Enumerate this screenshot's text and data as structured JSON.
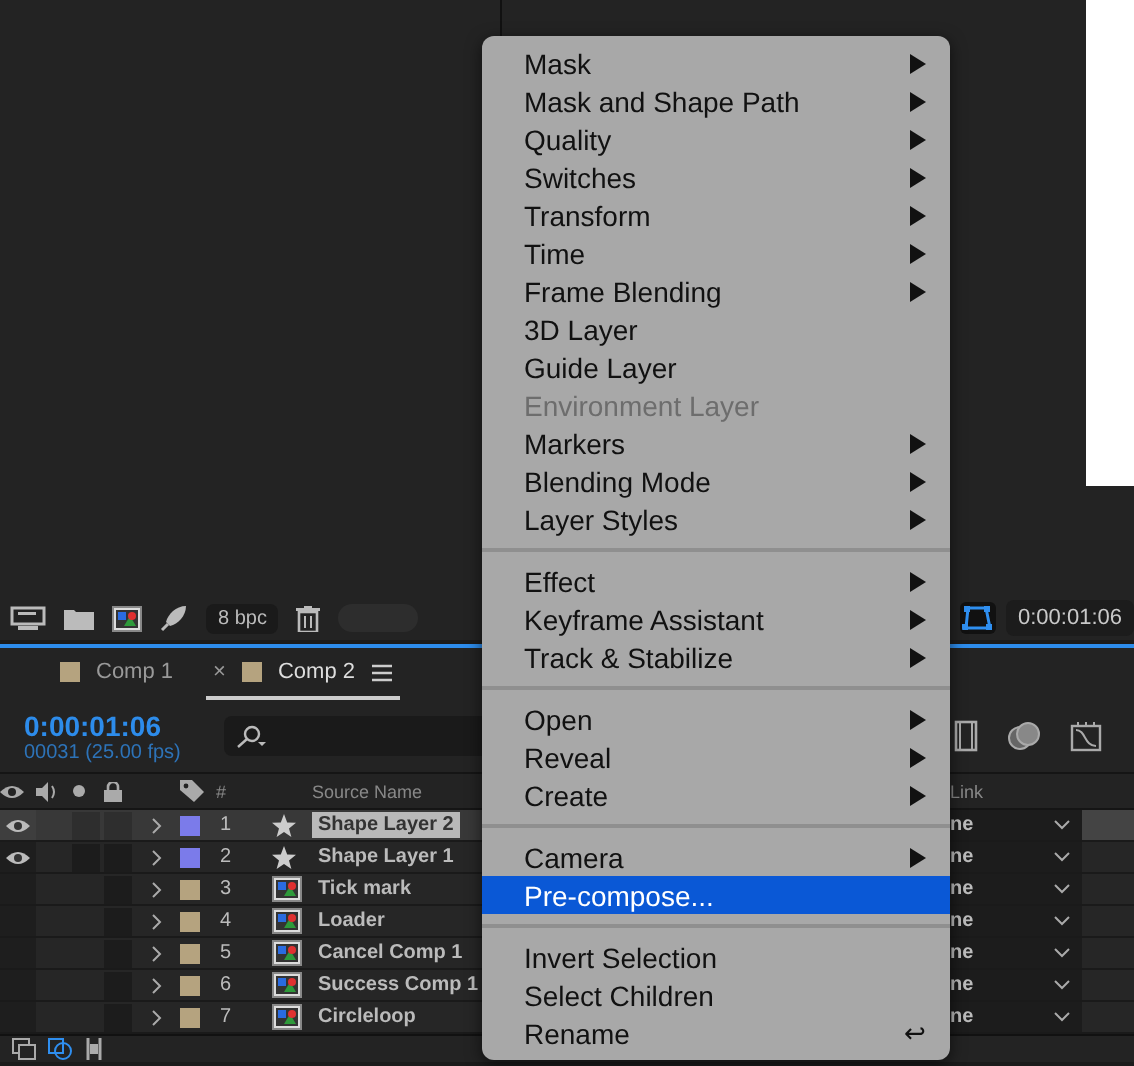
{
  "viewer": {
    "toolbar": {
      "bit_depth": "8 bpc",
      "time": "0:00:01:06"
    }
  },
  "timeline": {
    "tabs": [
      {
        "label": "Comp 1",
        "color": "#b5a37f",
        "selected": false
      },
      {
        "label": "Comp 2",
        "color": "#b5a37f",
        "selected": true,
        "close": "×"
      }
    ],
    "current_time": "0:00:01:06",
    "frame_info": "00031 (25.00 fps)",
    "columns": {
      "number": "#",
      "source_name": "Source Name",
      "parent": "Link"
    },
    "layers": [
      {
        "number": "1",
        "name": "Shape Layer 2",
        "color": "#7b7bea",
        "kind": "shape",
        "visible": true,
        "selected": true,
        "parent": "ne"
      },
      {
        "number": "2",
        "name": "Shape Layer 1",
        "color": "#7b7bea",
        "kind": "shape",
        "visible": true,
        "selected": false,
        "parent": "ne"
      },
      {
        "number": "3",
        "name": "Tick mark",
        "color": "#b5a37f",
        "kind": "comp",
        "visible": false,
        "selected": false,
        "parent": "ne"
      },
      {
        "number": "4",
        "name": "Loader",
        "color": "#b5a37f",
        "kind": "comp",
        "visible": false,
        "selected": false,
        "parent": "ne"
      },
      {
        "number": "5",
        "name": "Cancel Comp 1",
        "color": "#b5a37f",
        "kind": "comp",
        "visible": false,
        "selected": false,
        "parent": "ne"
      },
      {
        "number": "6",
        "name": "Success Comp 1",
        "color": "#b5a37f",
        "kind": "comp",
        "visible": false,
        "selected": false,
        "parent": "ne"
      },
      {
        "number": "7",
        "name": "Circleloop",
        "color": "#b5a37f",
        "kind": "comp",
        "visible": false,
        "selected": false,
        "parent": "ne"
      }
    ]
  },
  "context_menu": {
    "groups": [
      [
        {
          "label": "Mask",
          "submenu": true,
          "disabled": false,
          "selected": false
        },
        {
          "label": "Mask and Shape Path",
          "submenu": true,
          "disabled": false,
          "selected": false
        },
        {
          "label": "Quality",
          "submenu": true,
          "disabled": false,
          "selected": false
        },
        {
          "label": "Switches",
          "submenu": true,
          "disabled": false,
          "selected": false
        },
        {
          "label": "Transform",
          "submenu": true,
          "disabled": false,
          "selected": false
        },
        {
          "label": "Time",
          "submenu": true,
          "disabled": false,
          "selected": false
        },
        {
          "label": "Frame Blending",
          "submenu": true,
          "disabled": false,
          "selected": false
        },
        {
          "label": "3D Layer",
          "submenu": false,
          "disabled": false,
          "selected": false
        },
        {
          "label": "Guide Layer",
          "submenu": false,
          "disabled": false,
          "selected": false
        },
        {
          "label": "Environment Layer",
          "submenu": false,
          "disabled": true,
          "selected": false
        },
        {
          "label": "Markers",
          "submenu": true,
          "disabled": false,
          "selected": false
        },
        {
          "label": "Blending Mode",
          "submenu": true,
          "disabled": false,
          "selected": false
        },
        {
          "label": "Layer Styles",
          "submenu": true,
          "disabled": false,
          "selected": false
        }
      ],
      [
        {
          "label": "Effect",
          "submenu": true,
          "disabled": false,
          "selected": false
        },
        {
          "label": "Keyframe Assistant",
          "submenu": true,
          "disabled": false,
          "selected": false
        },
        {
          "label": "Track & Stabilize",
          "submenu": true,
          "disabled": false,
          "selected": false
        }
      ],
      [
        {
          "label": "Open",
          "submenu": true,
          "disabled": false,
          "selected": false
        },
        {
          "label": "Reveal",
          "submenu": true,
          "disabled": false,
          "selected": false
        },
        {
          "label": "Create",
          "submenu": true,
          "disabled": false,
          "selected": false
        }
      ],
      [
        {
          "label": "Camera",
          "submenu": true,
          "disabled": false,
          "selected": false
        },
        {
          "label": "Pre-compose...",
          "submenu": false,
          "disabled": false,
          "selected": true
        }
      ],
      [
        {
          "label": "Invert Selection",
          "submenu": false,
          "disabled": false,
          "selected": false
        },
        {
          "label": "Select Children",
          "submenu": false,
          "disabled": false,
          "selected": false
        },
        {
          "label": "Rename",
          "submenu": false,
          "disabled": false,
          "selected": false,
          "shortcut": "↩"
        }
      ]
    ]
  }
}
